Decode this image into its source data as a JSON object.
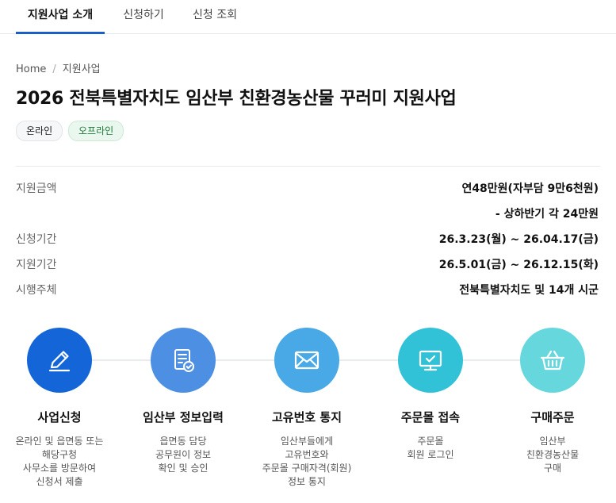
{
  "tabs": [
    {
      "label": "지원사업 소개"
    },
    {
      "label": "신청하기"
    },
    {
      "label": "신청 조회"
    }
  ],
  "breadcrumb": {
    "home": "Home",
    "current": "지원사업"
  },
  "title": "2026 전북특별자치도 임산부 친환경농산물 꾸러미 지원사업",
  "badges": {
    "online": "온라인",
    "offline": "오프라인"
  },
  "info": {
    "amount_label": "지원금액",
    "amount_value": "연48만원(자부담 9만6천원)",
    "amount_sub": "- 상하반기 각 24만원",
    "apply_label": "신청기간",
    "apply_value": "26.3.23(월) ~ 26.04.17(금)",
    "support_label": "지원기간",
    "support_value": "26.5.01(금) ~ 26.12.15(화)",
    "org_label": "시행주체",
    "org_value": "전북특별자치도 및 14개 시군"
  },
  "steps": [
    {
      "title": "사업신청",
      "icon": "pen-icon",
      "color": "#1466d8",
      "desc": [
        "온라인 및 읍면동 또는",
        "해당구청",
        "사무소를 방문하여",
        "신청서 제출"
      ]
    },
    {
      "title": "임산부 정보입력",
      "icon": "document-check-icon",
      "color": "#4d8fe3",
      "desc": [
        "읍면동 담당",
        "공무원이 정보",
        "확인 및 승인"
      ]
    },
    {
      "title": "고유번호 통지",
      "icon": "envelope-icon",
      "color": "#49a8e6",
      "desc": [
        "임산부들에게",
        "고유번호와",
        "주문몰 구매자격(회원)",
        "정보 통지"
      ]
    },
    {
      "title": "주문몰 접속",
      "icon": "monitor-check-icon",
      "color": "#31c2d8",
      "desc": [
        "주문몰",
        "회원 로그인"
      ]
    },
    {
      "title": "구매주문",
      "icon": "basket-icon",
      "color": "#66d7dd",
      "desc": [
        "임산부",
        "친환경농산물",
        "구매"
      ]
    }
  ]
}
